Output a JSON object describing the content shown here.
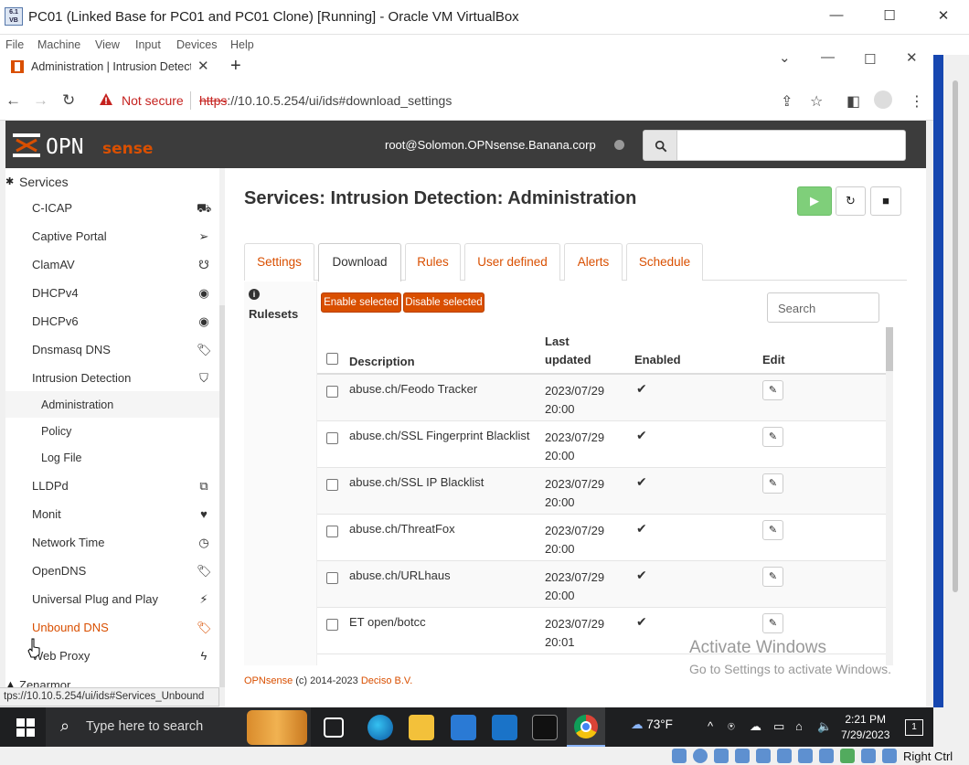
{
  "vm": {
    "title": "PC01 (Linked Base for PC01 and PC01 Clone) [Running] - Oracle VM VirtualBox",
    "menu": [
      "File",
      "Machine",
      "View",
      "Input",
      "Devices",
      "Help"
    ],
    "host_key": "Right Ctrl"
  },
  "browser": {
    "tab_title": "Administration | Intrusion Detect",
    "not_secure": "Not secure",
    "url_scheme": "https",
    "url_rest": "://10.10.5.254/ui/ids#download_settings",
    "status_url": "tps://10.10.5.254/ui/ids#Services_Unbound"
  },
  "header": {
    "logo": "OPNsense",
    "user": "root@Solomon.OPNsense.Banana.corp",
    "search_placeholder": ""
  },
  "sidebar": {
    "section": "Services",
    "items": [
      {
        "label": "C-ICAP",
        "icon": "truck-icon"
      },
      {
        "label": "Captive Portal",
        "icon": "paper-plane-icon"
      },
      {
        "label": "ClamAV",
        "icon": "stethoscope-icon"
      },
      {
        "label": "DHCPv4",
        "icon": "bullseye-icon"
      },
      {
        "label": "DHCPv6",
        "icon": "bullseye-icon"
      },
      {
        "label": "Dnsmasq DNS",
        "icon": "tags-icon"
      },
      {
        "label": "Intrusion Detection",
        "icon": "shield-icon"
      },
      {
        "label": "Administration",
        "sub": true,
        "active": true
      },
      {
        "label": "Policy",
        "sub": true
      },
      {
        "label": "Log File",
        "sub": true
      },
      {
        "label": "LLDPd",
        "icon": "binoculars-icon"
      },
      {
        "label": "Monit",
        "icon": "heartbeat-icon"
      },
      {
        "label": "Network Time",
        "icon": "clock-icon"
      },
      {
        "label": "OpenDNS",
        "icon": "tags-icon"
      },
      {
        "label": "Universal Plug and Play",
        "icon": "plug-icon"
      },
      {
        "label": "Unbound DNS",
        "icon": "tags-icon",
        "highlight": true
      },
      {
        "label": "Web Proxy",
        "icon": "bolt-icon"
      }
    ],
    "next_section": "Zenarmor"
  },
  "page": {
    "title": "Services: Intrusion Detection: Administration",
    "tabs": [
      "Settings",
      "Download",
      "Rules",
      "User defined",
      "Alerts",
      "Schedule"
    ],
    "selected_tab": "Download",
    "side_label": "Rulesets",
    "enable_selected": "Enable selected",
    "disable_selected": "Disable selected",
    "grid_search_placeholder": "Search",
    "columns": {
      "description": "Description",
      "updated_1": "Last",
      "updated_2": "updated",
      "enabled": "Enabled",
      "edit": "Edit"
    },
    "rows": [
      {
        "description": "abuse.ch/Feodo Tracker",
        "date": "2023/07/29",
        "time": "20:00",
        "enabled": true
      },
      {
        "description": "abuse.ch/SSL Fingerprint Blacklist",
        "date": "2023/07/29",
        "time": "20:00",
        "enabled": true
      },
      {
        "description": "abuse.ch/SSL IP Blacklist",
        "date": "2023/07/29",
        "time": "20:00",
        "enabled": true
      },
      {
        "description": "abuse.ch/ThreatFox",
        "date": "2023/07/29",
        "time": "20:00",
        "enabled": true
      },
      {
        "description": "abuse.ch/URLhaus",
        "date": "2023/07/29",
        "time": "20:00",
        "enabled": true
      },
      {
        "description": "ET open/botcc",
        "date": "2023/07/29",
        "time": "20:01",
        "enabled": true
      }
    ],
    "footer_brand": "OPNsense",
    "footer_text": " (c) 2014-2023 ",
    "footer_company": "Deciso B.V.",
    "watermark_1": "Activate Windows",
    "watermark_2": "Go to Settings to activate Windows."
  },
  "taskbar": {
    "search": "Type here to search",
    "weather": "73°F",
    "time": "2:21 PM",
    "date": "7/29/2023",
    "notifications": "1"
  },
  "colors": {
    "accent": "#d94f00",
    "header": "#3c3c3c",
    "play": "#7fcf7a"
  }
}
